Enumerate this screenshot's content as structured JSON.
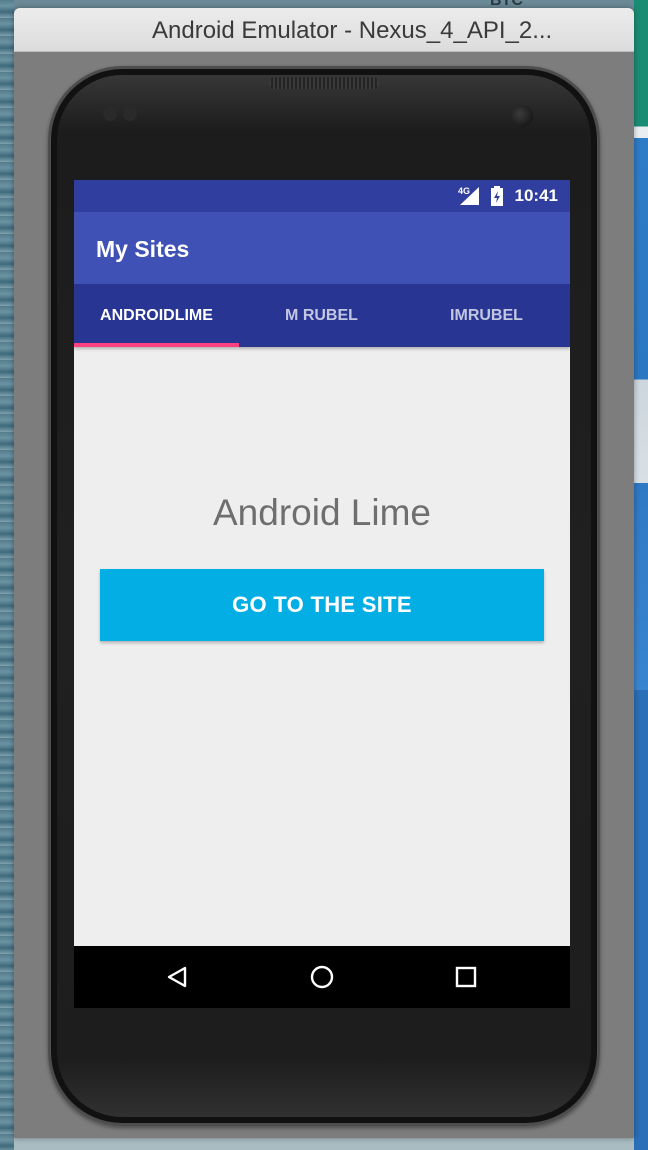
{
  "window": {
    "title": "Android Emulator - Nexus_4_API_2..."
  },
  "desktop": {
    "partial_text": "BTC"
  },
  "status_bar": {
    "network_label": "4G",
    "time": "10:41"
  },
  "app_bar": {
    "title": "My Sites"
  },
  "tabs": [
    {
      "label": "ANDROIDLIME",
      "selected": true
    },
    {
      "label": "M RUBEL",
      "selected": false
    },
    {
      "label": "IMRUBEL",
      "selected": false
    }
  ],
  "content": {
    "title": "Android Lime",
    "button_label": "GO TO THE SITE"
  },
  "nav_bar": {
    "buttons": [
      "back-icon",
      "home-icon",
      "recents-icon"
    ]
  },
  "colors": {
    "status_bar": "#303f9f",
    "app_bar": "#3f51b5",
    "tab_bar": "#283593",
    "tab_indicator": "#ff4081",
    "button": "#03aee4",
    "screen_background": "#eeeeee"
  }
}
